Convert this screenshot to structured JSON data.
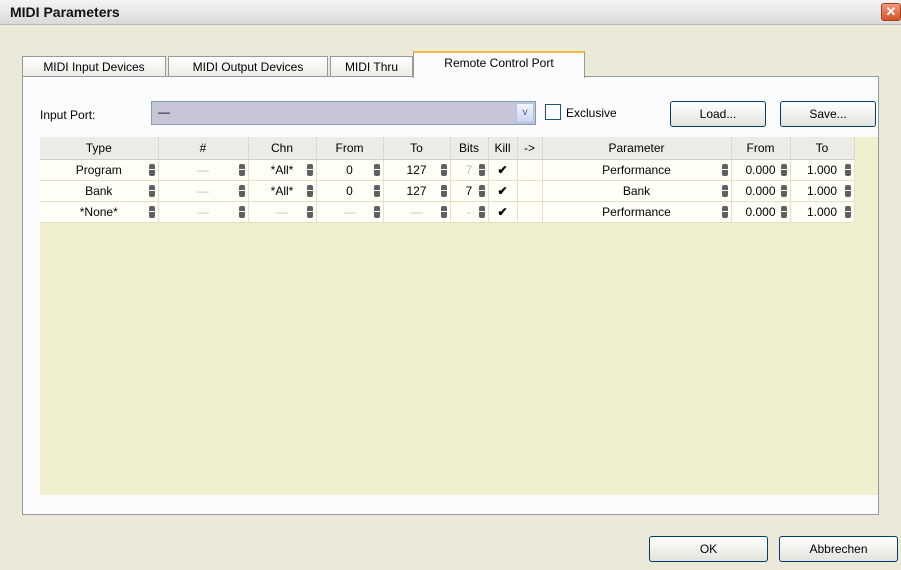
{
  "window": {
    "title": "MIDI Parameters",
    "close_glyph": "✕"
  },
  "tabs": [
    {
      "label": "MIDI Input Devices",
      "active": false
    },
    {
      "label": "MIDI Output Devices",
      "active": false
    },
    {
      "label": "MIDI Thru",
      "active": false
    },
    {
      "label": "Remote Control Port",
      "active": true
    }
  ],
  "input_port": {
    "label": "Input Port:",
    "value": "—",
    "arrow": "v"
  },
  "exclusive": {
    "label": "Exclusive",
    "checked": false
  },
  "buttons": {
    "load": "Load...",
    "save": "Save...",
    "ok": "OK",
    "cancel": "Abbrechen"
  },
  "grid": {
    "headers": [
      "Type",
      "#",
      "Chn",
      "From",
      "To",
      "Bits",
      "Kill",
      "->",
      "Parameter",
      "From",
      "To"
    ],
    "rows": [
      {
        "type": "Program",
        "num": "—",
        "chn": "*All*",
        "from": "0",
        "to": "127",
        "bits": "7",
        "bits_dim": true,
        "kill": "✔",
        "param": "Performance",
        "pfrom": "0.000",
        "pto": "1.000"
      },
      {
        "type": "Bank",
        "num": "—",
        "chn": "*All*",
        "from": "0",
        "to": "127",
        "bits": "7",
        "bits_dim": false,
        "kill": "✔",
        "param": "Bank",
        "pfrom": "0.000",
        "pto": "1.000"
      },
      {
        "type": "*None*",
        "num": "—",
        "chn": "—",
        "from": "—",
        "to": "—",
        "bits": "-",
        "bits_dim": true,
        "kill": "✔",
        "param": "Performance",
        "pfrom": "0.000",
        "pto": "1.000"
      }
    ]
  }
}
